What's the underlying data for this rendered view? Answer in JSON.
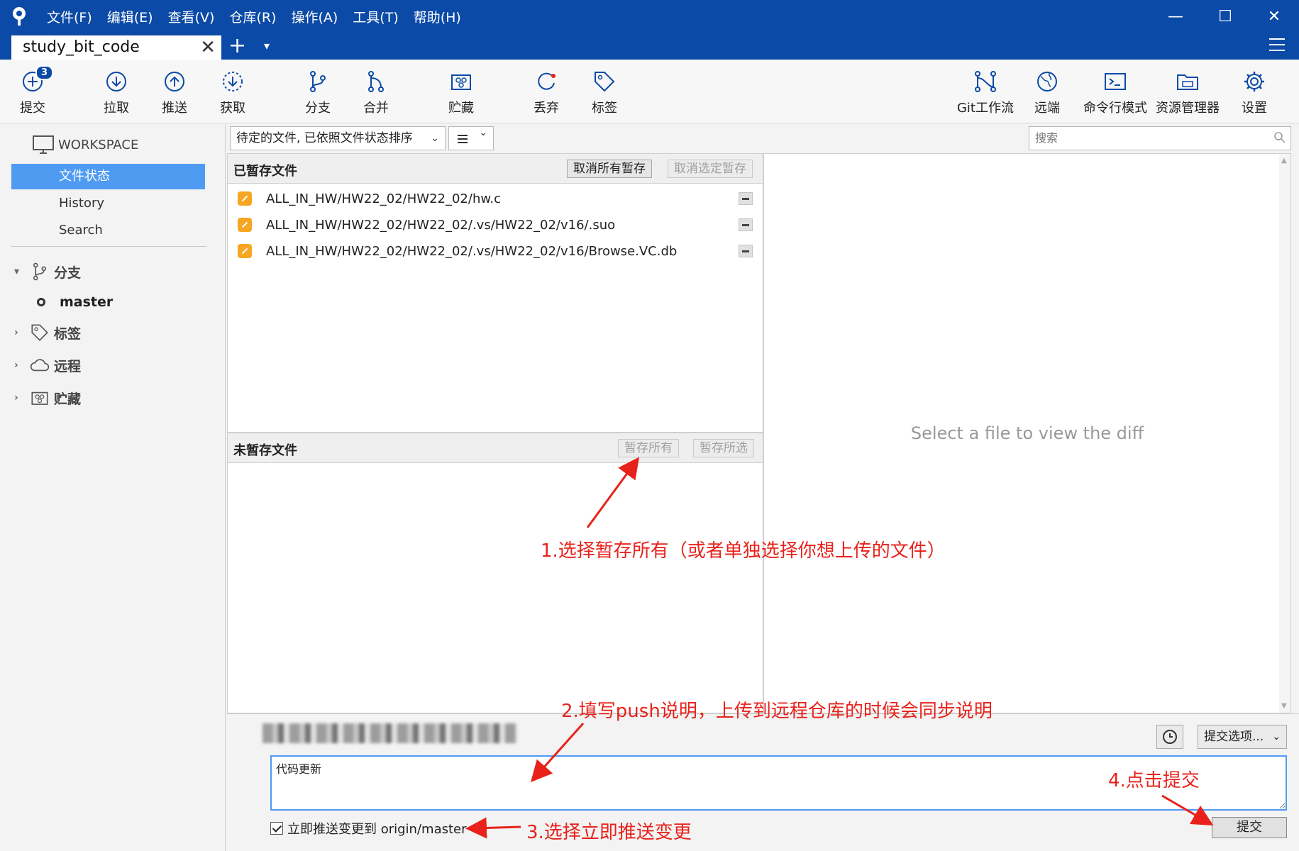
{
  "window": {
    "menu": [
      "文件(F)",
      "编辑(E)",
      "查看(V)",
      "仓库(R)",
      "操作(A)",
      "工具(T)",
      "帮助(H)"
    ],
    "controls": {
      "minimize": "—",
      "maximize": "☐",
      "close": "✕"
    }
  },
  "tab": {
    "title": "study_bit_code",
    "close": "✕",
    "add": "+",
    "dropdown": "▾"
  },
  "toolbar": {
    "commit": "提交",
    "commit_badge": "3",
    "pull": "拉取",
    "push": "推送",
    "fetch": "获取",
    "branch": "分支",
    "merge": "合并",
    "stash": "贮藏",
    "discard": "丢弃",
    "tag": "标签",
    "gitflow": "Git工作流",
    "remote": "远端",
    "terminal": "命令行模式",
    "explorer": "资源管理器",
    "settings": "设置"
  },
  "sidebar": {
    "workspace": "WORKSPACE",
    "items": [
      "文件状态",
      "History",
      "Search"
    ],
    "branches": "分支",
    "current_branch": "master",
    "tags": "标签",
    "remotes": "远程",
    "stashes": "贮藏"
  },
  "filter": {
    "sort": "待定的文件, 已依照文件状态排序",
    "search_placeholder": "搜索"
  },
  "staged": {
    "title": "已暂存文件",
    "unstage_all": "取消所有暂存",
    "unstage_selected": "取消选定暂存",
    "files": [
      "ALL_IN_HW/HW22_02/HW22_02/hw.c",
      "ALL_IN_HW/HW22_02/HW22_02/.vs/HW22_02/v16/.suo",
      "ALL_IN_HW/HW22_02/HW22_02/.vs/HW22_02/v16/Browse.VC.db"
    ]
  },
  "unstaged": {
    "title": "未暂存文件",
    "stage_all": "暂存所有",
    "stage_selected": "暂存所选"
  },
  "diff": {
    "empty": "Select a file to view the diff"
  },
  "commit": {
    "options": "提交选项...",
    "message": "代码更新",
    "push_label": "立即推送变更到 origin/master",
    "button": "提交"
  },
  "annotations": {
    "step1": "1.选择暂存所有（或者单独选择你想上传的文件）",
    "step2": "2.填写push说明，上传到远程仓库的时候会同步说明",
    "step3": "3.选择立即推送变更",
    "step4": "4.点击提交"
  },
  "colors": {
    "titlebar": "#0b4aa6",
    "selection": "#4f9bf2",
    "annotation": "#e8221b",
    "modified": "#f6a623"
  }
}
